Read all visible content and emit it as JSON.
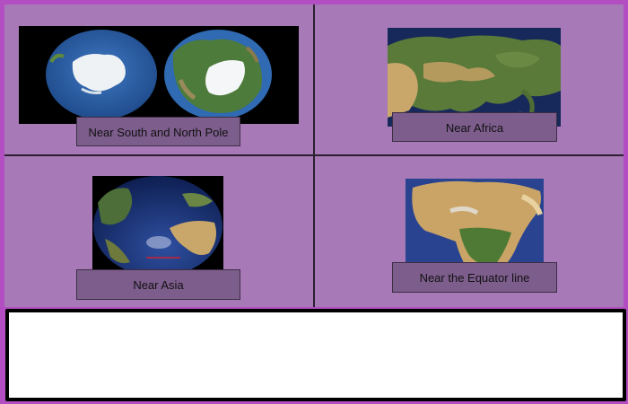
{
  "options": [
    {
      "label": "Near South and North Pole",
      "picture": "two-globes-polar-views"
    },
    {
      "label": "Near Africa",
      "picture": "asia-satellite-map"
    },
    {
      "label": "Near Asia",
      "picture": "atlantic-globe-view"
    },
    {
      "label": "Near the Equator line",
      "picture": "africa-satellite-map"
    }
  ],
  "colors": {
    "background": "#b24ec2",
    "panel": "#a77ab7",
    "button": "#7d5d8c"
  }
}
